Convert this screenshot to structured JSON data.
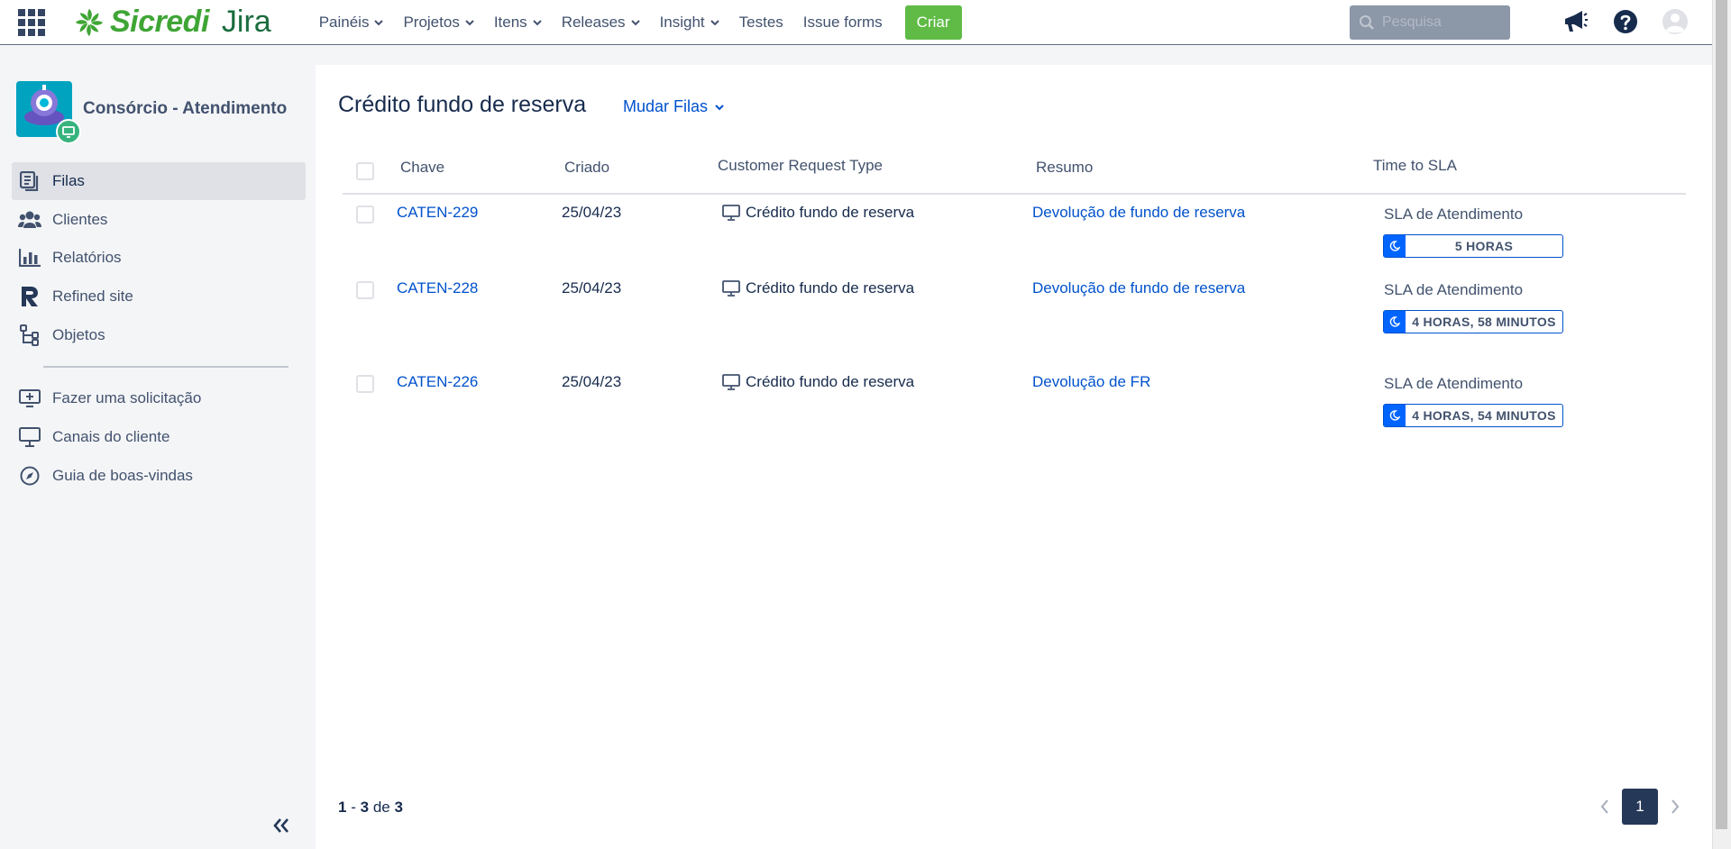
{
  "nav": {
    "brand": "Sicredi",
    "product": "Jira",
    "items": [
      {
        "label": "Painéis",
        "dropdown": true
      },
      {
        "label": "Projetos",
        "dropdown": true
      },
      {
        "label": "Itens",
        "dropdown": true
      },
      {
        "label": "Releases",
        "dropdown": true
      },
      {
        "label": "Insight",
        "dropdown": true
      },
      {
        "label": "Testes",
        "dropdown": false
      },
      {
        "label": "Issue forms",
        "dropdown": false
      }
    ],
    "create_label": "Criar",
    "search_placeholder": "Pesquisa",
    "icons": [
      "app-switcher-icon",
      "notifications-megaphone-icon",
      "help-icon",
      "user-avatar-icon"
    ]
  },
  "sidebar": {
    "project_name": "Consórcio - Atendimento",
    "items": [
      {
        "label": "Filas",
        "icon": "queues-icon",
        "active": true
      },
      {
        "label": "Clientes",
        "icon": "customers-icon",
        "active": false
      },
      {
        "label": "Relatórios",
        "icon": "reports-icon",
        "active": false
      },
      {
        "label": "Refined site",
        "icon": "refined-icon",
        "active": false
      },
      {
        "label": "Objetos",
        "icon": "objects-icon",
        "active": false
      },
      {
        "label": "Fazer uma solicitação",
        "icon": "raise-request-icon",
        "active": false
      },
      {
        "label": "Canais do cliente",
        "icon": "customer-channels-icon",
        "active": false
      },
      {
        "label": "Guia de boas-vindas",
        "icon": "welcome-guide-icon",
        "active": false
      }
    ]
  },
  "main": {
    "title": "Crédito fundo de reserva",
    "change_queue_label": "Mudar Filas",
    "columns": [
      "Chave",
      "Criado",
      "Customer Request Type",
      "Resumo",
      "Time to SLA"
    ],
    "rows": [
      {
        "key": "CATEN-229",
        "created": "25/04/23",
        "request_type": "Crédito fundo de reserva",
        "summary": "Devolução de fundo de reserva",
        "sla_name": "SLA de Atendimento",
        "sla_time": "5 HORAS"
      },
      {
        "key": "CATEN-228",
        "created": "25/04/23",
        "request_type": "Crédito fundo de reserva",
        "summary": "Devolução de fundo de reserva",
        "sla_name": "SLA de Atendimento",
        "sla_time": "4 HORAS, 58 MINUTOS"
      },
      {
        "key": "CATEN-226",
        "created": "25/04/23",
        "request_type": "Crédito fundo de reserva",
        "summary": "Devolução de FR",
        "sla_name": "SLA de Atendimento",
        "sla_time": "4 HORAS, 54 MINUTOS"
      }
    ],
    "pagination": {
      "from": "1",
      "sep": "-",
      "to": "3",
      "of_label": "de",
      "total": "3",
      "current_page": "1"
    }
  },
  "colors": {
    "brand_green": "#3fa535",
    "create_green": "#5fbb46",
    "link_blue": "#0052cc",
    "sla_blue": "#0065ff"
  }
}
